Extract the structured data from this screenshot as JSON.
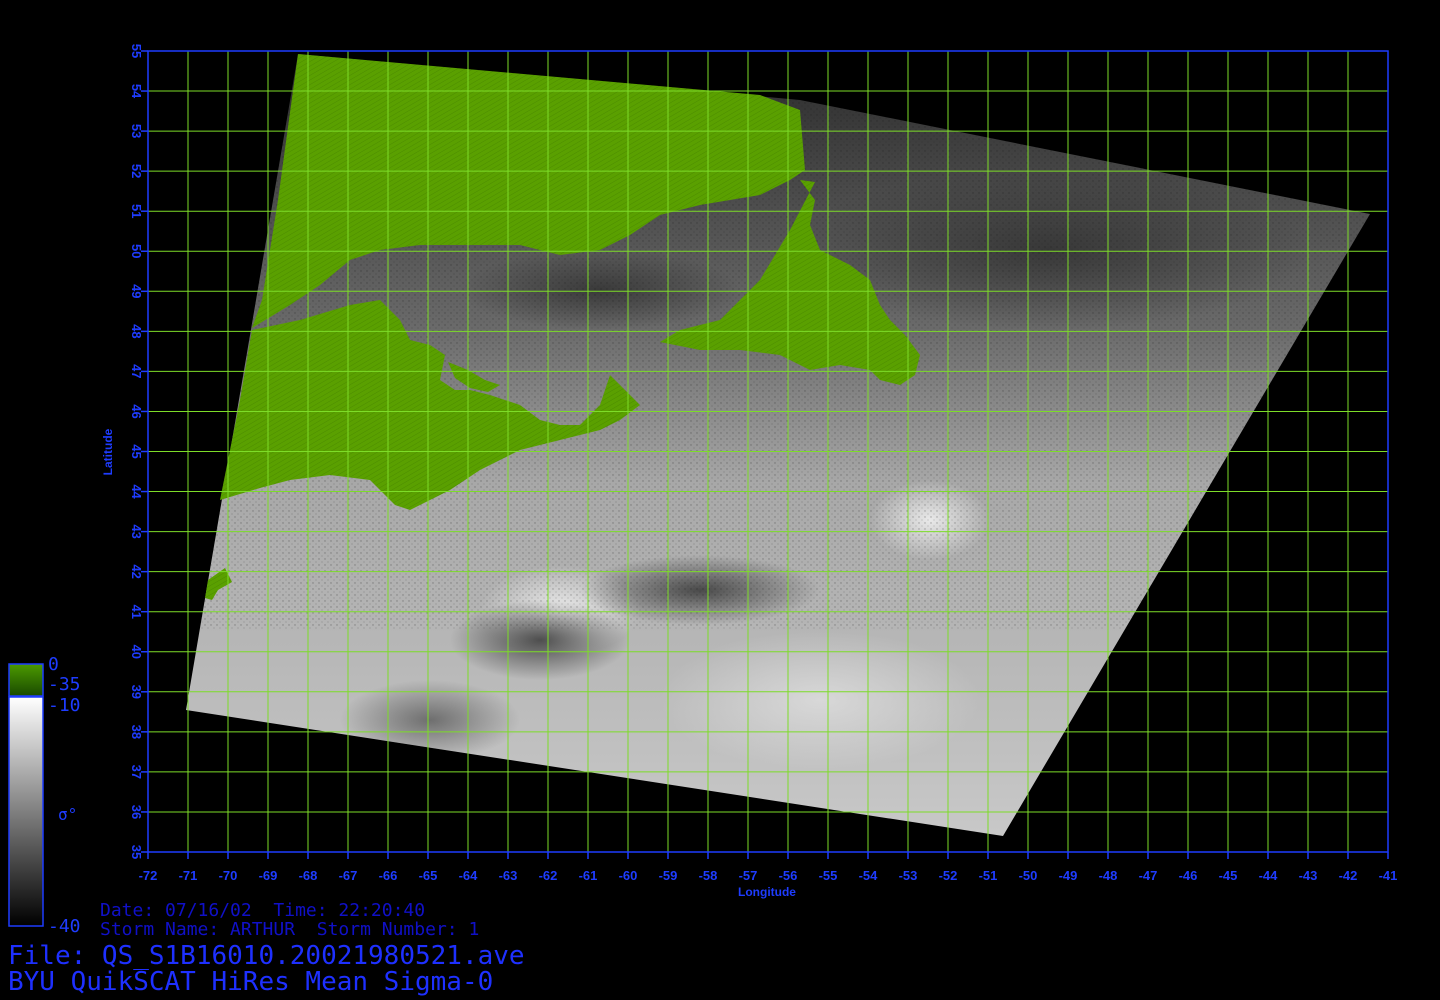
{
  "map": {
    "lon_ticks": [
      "-72",
      "-71",
      "-70",
      "-69",
      "-68",
      "-67",
      "-66",
      "-65",
      "-64",
      "-63",
      "-62",
      "-61",
      "-60",
      "-59",
      "-58",
      "-57",
      "-56",
      "-55",
      "-54",
      "-53",
      "-52",
      "-51",
      "-50",
      "-49",
      "-48",
      "-47",
      "-46",
      "-45",
      "-44",
      "-43",
      "-42",
      "-41"
    ],
    "lat_ticks": [
      "35",
      "36",
      "37",
      "38",
      "39",
      "40",
      "41",
      "42",
      "43",
      "44",
      "45",
      "46",
      "47",
      "48",
      "49",
      "50",
      "51",
      "52",
      "53",
      "54",
      "55"
    ],
    "x_label": "Longitude",
    "y_label": "Latitude",
    "colors": {
      "grid": "#7ddc28",
      "axis": "#1e3cff",
      "land": "#5aa000",
      "ocean_light": "#cfcfcf",
      "ocean_dark": "#3a3a3a"
    }
  },
  "legend": {
    "land_top": "0",
    "land_bottom": "-35",
    "sea_top": "-10",
    "sea_bottom": "-40",
    "symbol": "σ°"
  },
  "info": {
    "date_line": "Date: 07/16/02  Time: 22:20:40",
    "storm_line": "Storm Name: ARTHUR  Storm Number: 1",
    "file_line": "File: QS_S1B16010.20021980521.ave",
    "title_line": "BYU QuikSCAT HiRes Mean Sigma-0"
  }
}
